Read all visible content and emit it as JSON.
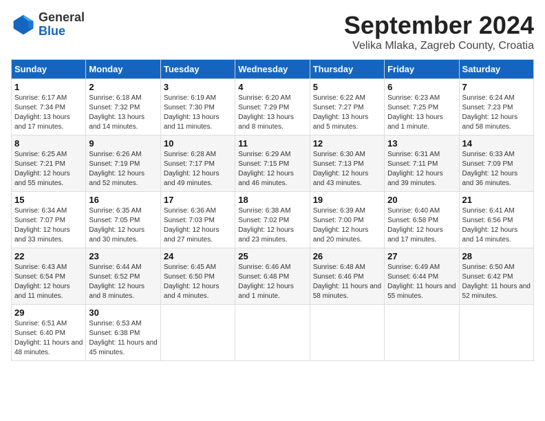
{
  "header": {
    "logo_general": "General",
    "logo_blue": "Blue",
    "month_title": "September 2024",
    "location": "Velika Mlaka, Zagreb County, Croatia"
  },
  "days_of_week": [
    "Sunday",
    "Monday",
    "Tuesday",
    "Wednesday",
    "Thursday",
    "Friday",
    "Saturday"
  ],
  "weeks": [
    [
      {
        "day": "1",
        "sunrise": "6:17 AM",
        "sunset": "7:34 PM",
        "daylight": "13 hours and 17 minutes."
      },
      {
        "day": "2",
        "sunrise": "6:18 AM",
        "sunset": "7:32 PM",
        "daylight": "13 hours and 14 minutes."
      },
      {
        "day": "3",
        "sunrise": "6:19 AM",
        "sunset": "7:30 PM",
        "daylight": "13 hours and 11 minutes."
      },
      {
        "day": "4",
        "sunrise": "6:20 AM",
        "sunset": "7:29 PM",
        "daylight": "13 hours and 8 minutes."
      },
      {
        "day": "5",
        "sunrise": "6:22 AM",
        "sunset": "7:27 PM",
        "daylight": "13 hours and 5 minutes."
      },
      {
        "day": "6",
        "sunrise": "6:23 AM",
        "sunset": "7:25 PM",
        "daylight": "13 hours and 1 minute."
      },
      {
        "day": "7",
        "sunrise": "6:24 AM",
        "sunset": "7:23 PM",
        "daylight": "12 hours and 58 minutes."
      }
    ],
    [
      {
        "day": "8",
        "sunrise": "6:25 AM",
        "sunset": "7:21 PM",
        "daylight": "12 hours and 55 minutes."
      },
      {
        "day": "9",
        "sunrise": "6:26 AM",
        "sunset": "7:19 PM",
        "daylight": "12 hours and 52 minutes."
      },
      {
        "day": "10",
        "sunrise": "6:28 AM",
        "sunset": "7:17 PM",
        "daylight": "12 hours and 49 minutes."
      },
      {
        "day": "11",
        "sunrise": "6:29 AM",
        "sunset": "7:15 PM",
        "daylight": "12 hours and 46 minutes."
      },
      {
        "day": "12",
        "sunrise": "6:30 AM",
        "sunset": "7:13 PM",
        "daylight": "12 hours and 43 minutes."
      },
      {
        "day": "13",
        "sunrise": "6:31 AM",
        "sunset": "7:11 PM",
        "daylight": "12 hours and 39 minutes."
      },
      {
        "day": "14",
        "sunrise": "6:33 AM",
        "sunset": "7:09 PM",
        "daylight": "12 hours and 36 minutes."
      }
    ],
    [
      {
        "day": "15",
        "sunrise": "6:34 AM",
        "sunset": "7:07 PM",
        "daylight": "12 hours and 33 minutes."
      },
      {
        "day": "16",
        "sunrise": "6:35 AM",
        "sunset": "7:05 PM",
        "daylight": "12 hours and 30 minutes."
      },
      {
        "day": "17",
        "sunrise": "6:36 AM",
        "sunset": "7:03 PM",
        "daylight": "12 hours and 27 minutes."
      },
      {
        "day": "18",
        "sunrise": "6:38 AM",
        "sunset": "7:02 PM",
        "daylight": "12 hours and 23 minutes."
      },
      {
        "day": "19",
        "sunrise": "6:39 AM",
        "sunset": "7:00 PM",
        "daylight": "12 hours and 20 minutes."
      },
      {
        "day": "20",
        "sunrise": "6:40 AM",
        "sunset": "6:58 PM",
        "daylight": "12 hours and 17 minutes."
      },
      {
        "day": "21",
        "sunrise": "6:41 AM",
        "sunset": "6:56 PM",
        "daylight": "12 hours and 14 minutes."
      }
    ],
    [
      {
        "day": "22",
        "sunrise": "6:43 AM",
        "sunset": "6:54 PM",
        "daylight": "12 hours and 11 minutes."
      },
      {
        "day": "23",
        "sunrise": "6:44 AM",
        "sunset": "6:52 PM",
        "daylight": "12 hours and 8 minutes."
      },
      {
        "day": "24",
        "sunrise": "6:45 AM",
        "sunset": "6:50 PM",
        "daylight": "12 hours and 4 minutes."
      },
      {
        "day": "25",
        "sunrise": "6:46 AM",
        "sunset": "6:48 PM",
        "daylight": "12 hours and 1 minute."
      },
      {
        "day": "26",
        "sunrise": "6:48 AM",
        "sunset": "6:46 PM",
        "daylight": "11 hours and 58 minutes."
      },
      {
        "day": "27",
        "sunrise": "6:49 AM",
        "sunset": "6:44 PM",
        "daylight": "11 hours and 55 minutes."
      },
      {
        "day": "28",
        "sunrise": "6:50 AM",
        "sunset": "6:42 PM",
        "daylight": "11 hours and 52 minutes."
      }
    ],
    [
      {
        "day": "29",
        "sunrise": "6:51 AM",
        "sunset": "6:40 PM",
        "daylight": "11 hours and 48 minutes."
      },
      {
        "day": "30",
        "sunrise": "6:53 AM",
        "sunset": "6:38 PM",
        "daylight": "11 hours and 45 minutes."
      },
      null,
      null,
      null,
      null,
      null
    ]
  ]
}
